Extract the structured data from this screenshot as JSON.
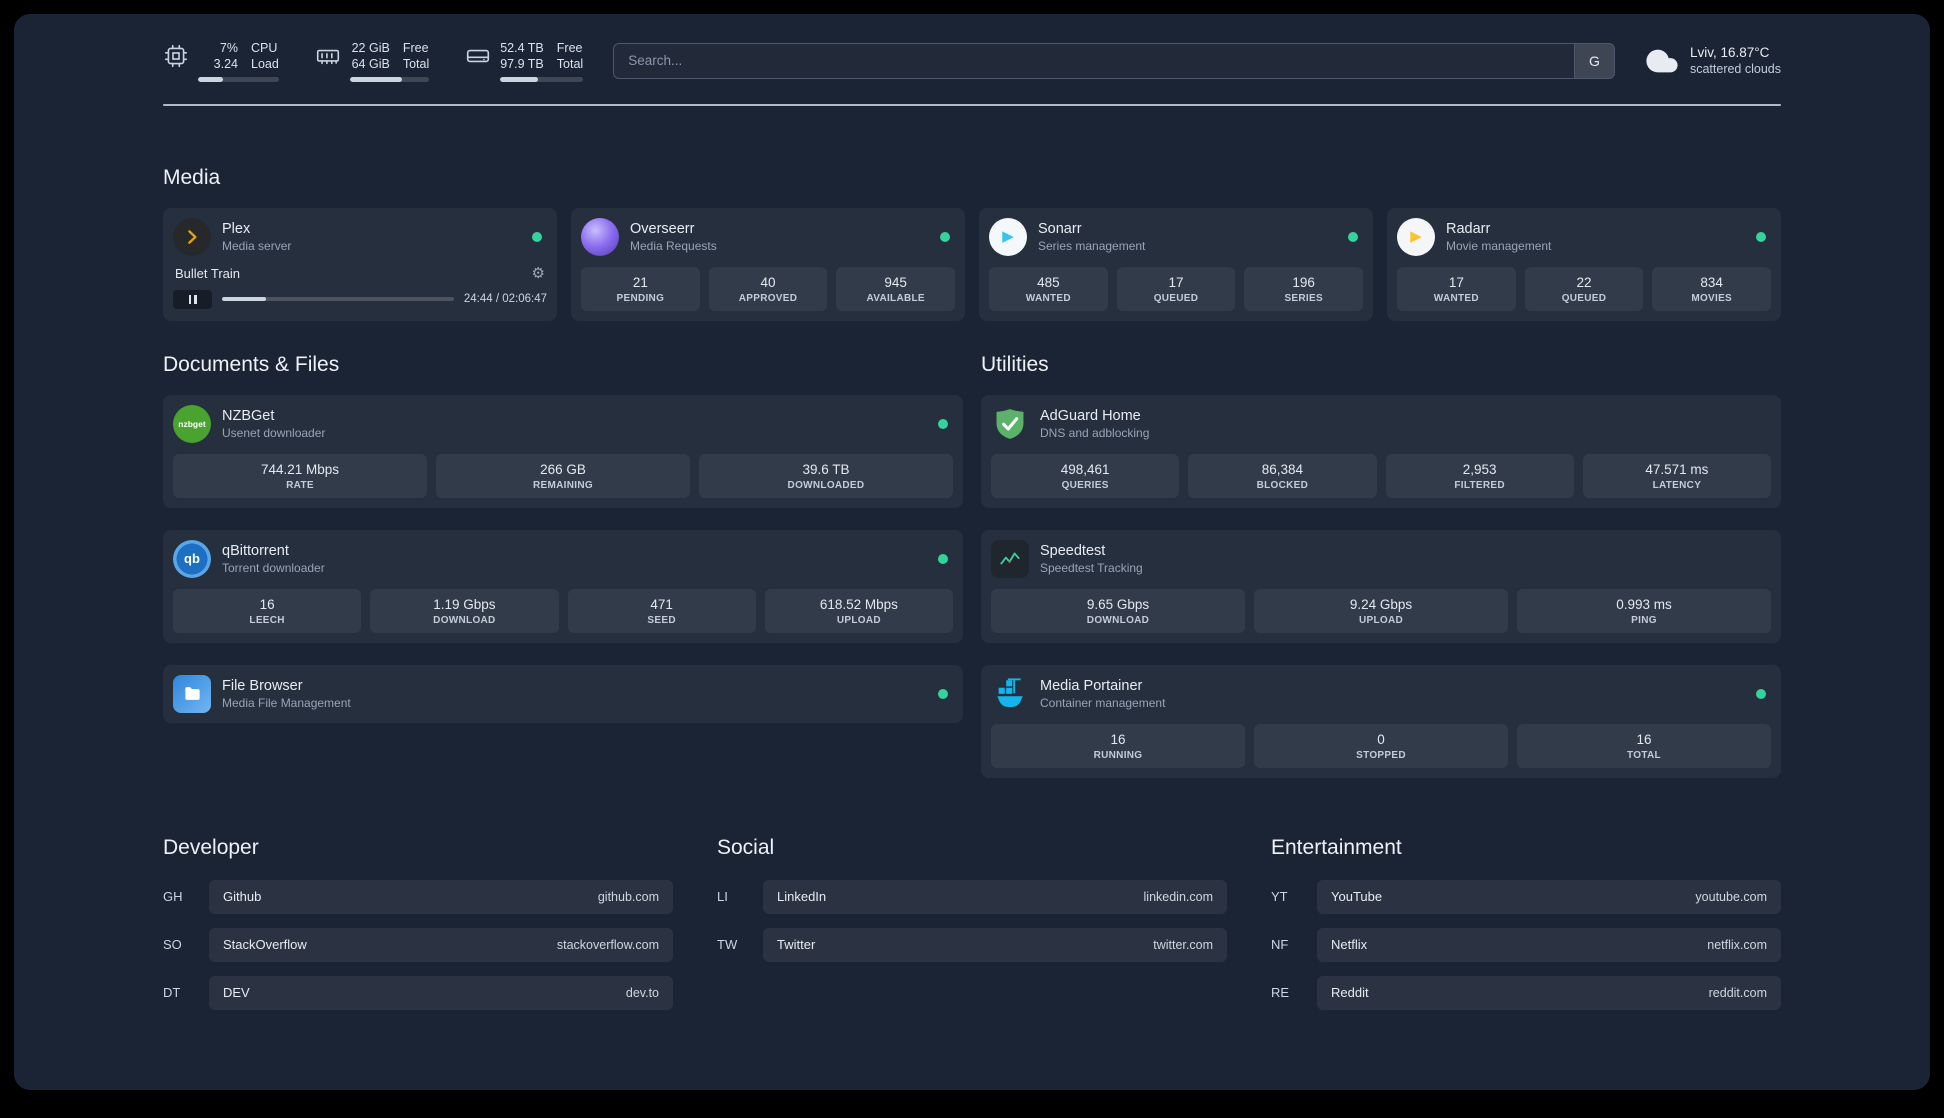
{
  "theme": {
    "panel_bg": "#1b2434",
    "card_bg": "rgba(255,255,255,0.05)",
    "stat_bg": "rgba(255,255,255,0.06)",
    "text_secondary": "#98a3b4",
    "status_online": "#34d399",
    "plex_accent": "#e5a00d",
    "sonarr_accent": "#35c5f4",
    "radarr_accent": "#ffc230",
    "nzbget_accent": "#4aa32f",
    "adguard_accent": "#5bb269",
    "speedtest_accent": "#36d39a",
    "portainer_accent": "#13b5ea"
  },
  "topbar": {
    "cpu": {
      "usage": "7%",
      "load": "3.24",
      "usage_label": "CPU",
      "load_label": "Load",
      "bar_pct": 31
    },
    "memory": {
      "free": "22 GiB",
      "total": "64 GiB",
      "free_label": "Free",
      "total_label": "Total",
      "bar_pct": 66
    },
    "disk": {
      "free": "52.4 TB",
      "total": "97.9 TB",
      "free_label": "Free",
      "total_label": "Total",
      "bar_pct": 46
    },
    "search": {
      "placeholder": "Search...",
      "button_label": "G"
    },
    "weather": {
      "location": "Lviv, 16.87°C",
      "condition": "scattered clouds"
    }
  },
  "sections": {
    "media": {
      "heading": "Media",
      "plex": {
        "name": "Plex",
        "desc": "Media server",
        "now_playing": "Bullet Train",
        "time": "24:44 / 02:06:47",
        "progress_pct": 19
      },
      "overseerr": {
        "name": "Overseerr",
        "desc": "Media Requests",
        "stats": [
          {
            "value": "21",
            "label": "PENDING"
          },
          {
            "value": "40",
            "label": "APPROVED"
          },
          {
            "value": "945",
            "label": "AVAILABLE"
          }
        ]
      },
      "sonarr": {
        "name": "Sonarr",
        "desc": "Series management",
        "stats": [
          {
            "value": "485",
            "label": "WANTED"
          },
          {
            "value": "17",
            "label": "QUEUED"
          },
          {
            "value": "196",
            "label": "SERIES"
          }
        ]
      },
      "radarr": {
        "name": "Radarr",
        "desc": "Movie management",
        "stats": [
          {
            "value": "17",
            "label": "WANTED"
          },
          {
            "value": "22",
            "label": "QUEUED"
          },
          {
            "value": "834",
            "label": "MOVIES"
          }
        ]
      }
    },
    "documents": {
      "heading": "Documents & Files",
      "nzbget": {
        "name": "NZBGet",
        "desc": "Usenet downloader",
        "icon_text": "nzbget",
        "stats": [
          {
            "value": "744.21 Mbps",
            "label": "RATE"
          },
          {
            "value": "266 GB",
            "label": "REMAINING"
          },
          {
            "value": "39.6 TB",
            "label": "DOWNLOADED"
          }
        ]
      },
      "qbittorrent": {
        "name": "qBittorrent",
        "desc": "Torrent downloader",
        "icon_text": "qb",
        "stats": [
          {
            "value": "16",
            "label": "LEECH"
          },
          {
            "value": "1.19 Gbps",
            "label": "DOWNLOAD"
          },
          {
            "value": "471",
            "label": "SEED"
          },
          {
            "value": "618.52 Mbps",
            "label": "UPLOAD"
          }
        ]
      },
      "filebrowser": {
        "name": "File Browser",
        "desc": "Media File Management"
      }
    },
    "utilities": {
      "heading": "Utilities",
      "adguard": {
        "name": "AdGuard Home",
        "desc": "DNS and adblocking",
        "stats": [
          {
            "value": "498,461",
            "label": "QUERIES"
          },
          {
            "value": "86,384",
            "label": "BLOCKED"
          },
          {
            "value": "2,953",
            "label": "FILTERED"
          },
          {
            "value": "47.571 ms",
            "label": "LATENCY"
          }
        ]
      },
      "speedtest": {
        "name": "Speedtest",
        "desc": "Speedtest Tracking",
        "stats": [
          {
            "value": "9.65 Gbps",
            "label": "DOWNLOAD"
          },
          {
            "value": "9.24 Gbps",
            "label": "UPLOAD"
          },
          {
            "value": "0.993 ms",
            "label": "PING"
          }
        ]
      },
      "portainer": {
        "name": "Media Portainer",
        "desc": "Container management",
        "stats": [
          {
            "value": "16",
            "label": "RUNNING"
          },
          {
            "value": "0",
            "label": "STOPPED"
          },
          {
            "value": "16",
            "label": "TOTAL"
          }
        ]
      }
    },
    "bookmarks": {
      "developer": {
        "heading": "Developer",
        "items": [
          {
            "abbr": "GH",
            "name": "Github",
            "url": "github.com"
          },
          {
            "abbr": "SO",
            "name": "StackOverflow",
            "url": "stackoverflow.com"
          },
          {
            "abbr": "DT",
            "name": "DEV",
            "url": "dev.to"
          }
        ]
      },
      "social": {
        "heading": "Social",
        "items": [
          {
            "abbr": "LI",
            "name": "LinkedIn",
            "url": "linkedin.com"
          },
          {
            "abbr": "TW",
            "name": "Twitter",
            "url": "twitter.com"
          }
        ]
      },
      "entertainment": {
        "heading": "Entertainment",
        "items": [
          {
            "abbr": "YT",
            "name": "YouTube",
            "url": "youtube.com"
          },
          {
            "abbr": "NF",
            "name": "Netflix",
            "url": "netflix.com"
          },
          {
            "abbr": "RE",
            "name": "Reddit",
            "url": "reddit.com"
          }
        ]
      }
    }
  }
}
